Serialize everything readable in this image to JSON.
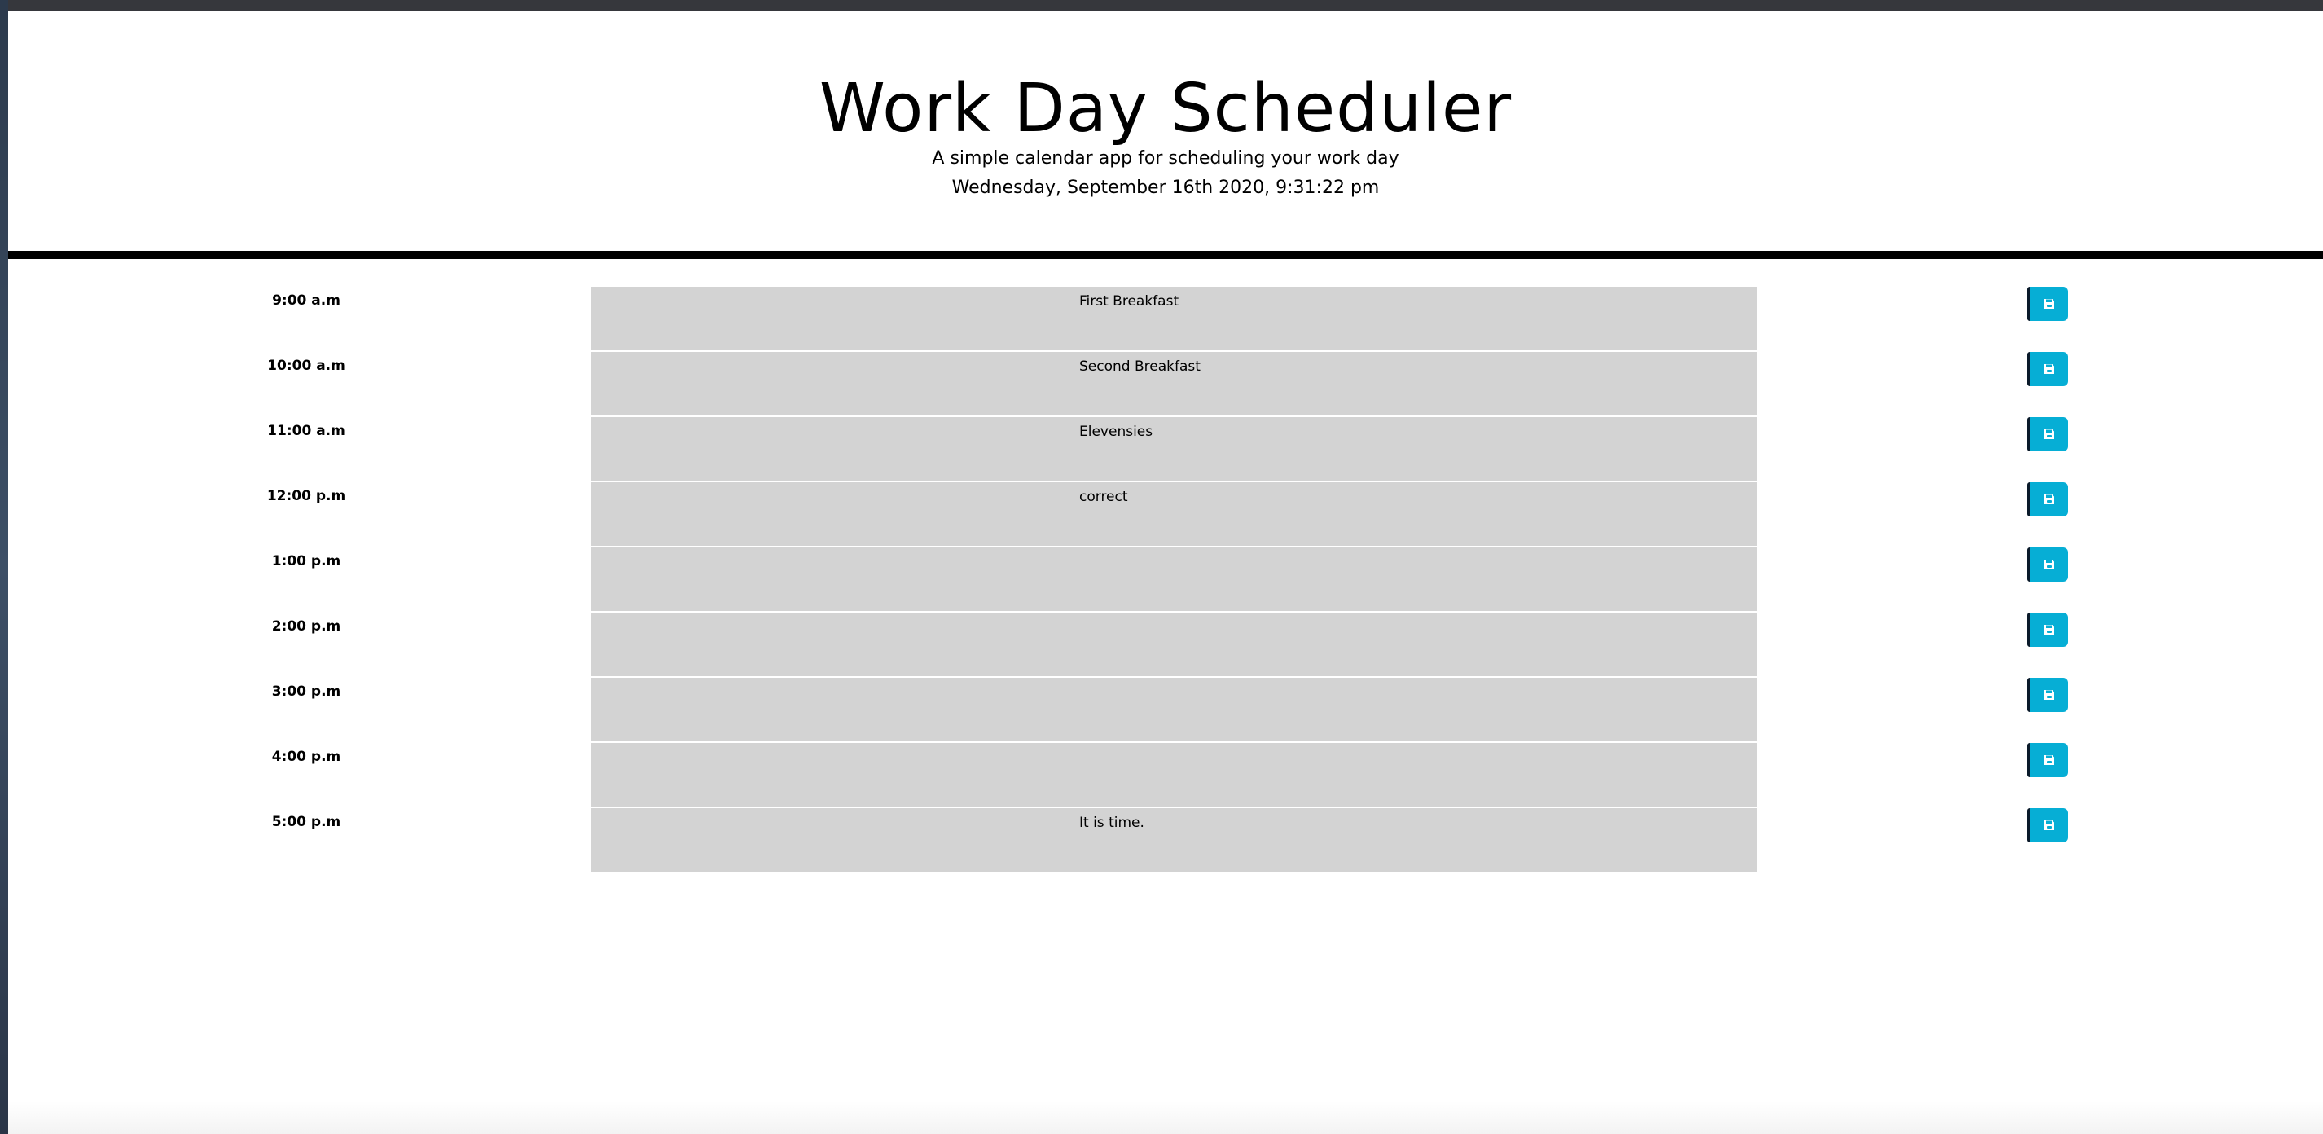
{
  "header": {
    "title": "Work Day Scheduler",
    "subtitle": "A simple calendar app for scheduling your work day",
    "current_day": "Wednesday, September 16th 2020, 9:31:22 pm"
  },
  "timeblocks": [
    {
      "hour": "9:00 a.m",
      "text": "First Breakfast"
    },
    {
      "hour": "10:00 a.m",
      "text": "Second Breakfast"
    },
    {
      "hour": "11:00 a.m",
      "text": "Elevensies"
    },
    {
      "hour": "12:00 p.m",
      "text": "correct"
    },
    {
      "hour": "1:00 p.m",
      "text": ""
    },
    {
      "hour": "2:00 p.m",
      "text": ""
    },
    {
      "hour": "3:00 p.m",
      "text": ""
    },
    {
      "hour": "4:00 p.m",
      "text": ""
    },
    {
      "hour": "5:00 p.m",
      "text": "It is time."
    }
  ],
  "icons": {
    "save": "floppy-disk-icon"
  },
  "colors": {
    "timeblock_bg": "#d3d3d3",
    "save_button": "#06aed5",
    "header_border": "#000000"
  }
}
